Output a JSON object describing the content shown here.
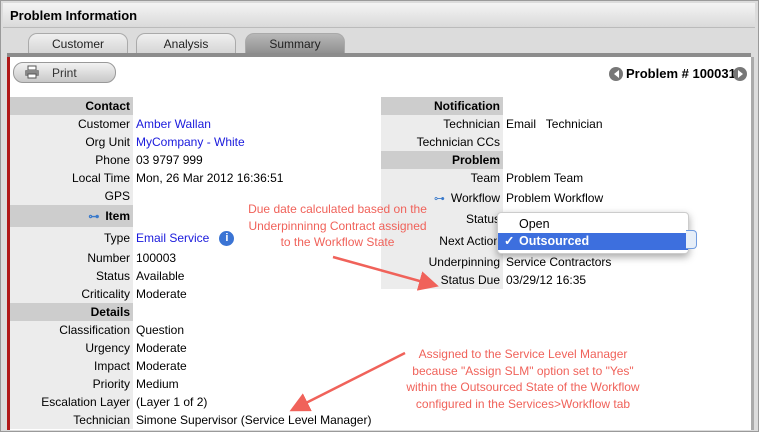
{
  "window": {
    "title": "Problem Information"
  },
  "tabs": [
    {
      "label": "Customer"
    },
    {
      "label": "Analysis"
    },
    {
      "label": "Summary",
      "active": true
    }
  ],
  "toolbar": {
    "print_label": "Print"
  },
  "problem_nav": {
    "label": "Problem # 100031"
  },
  "left": [
    {
      "label": "Contact",
      "header": true
    },
    {
      "label": "Customer",
      "value": "Amber Wallan",
      "link": true
    },
    {
      "label": "Org Unit",
      "value": "MyCompany - White",
      "link": true
    },
    {
      "label": "Phone",
      "value": "03 9797 999"
    },
    {
      "label": "Local Time",
      "value": "Mon, 26 Mar 2012 16:36:51"
    },
    {
      "label": "GPS",
      "value": ""
    },
    {
      "label": "Item",
      "header": true,
      "icon": "item-hierarchy-icon"
    },
    {
      "label": "Type",
      "value": "Email Service",
      "link": true,
      "icon": "info-icon"
    },
    {
      "label": "Number",
      "value": "100003"
    },
    {
      "label": "Status",
      "value": "Available"
    },
    {
      "label": "Criticality",
      "value": "Moderate"
    },
    {
      "label": "Details",
      "header": true
    },
    {
      "label": "Classification",
      "value": "Question"
    },
    {
      "label": "Urgency",
      "value": "Moderate"
    },
    {
      "label": "Impact",
      "value": "Moderate"
    },
    {
      "label": "Priority",
      "value": "Medium"
    },
    {
      "label": "Escalation Layer",
      "value": "(Layer 1 of 2)"
    },
    {
      "label": "Technician",
      "value": "Simone Supervisor (Service Level Manager)"
    }
  ],
  "right": [
    {
      "label": "Notification",
      "header": true
    },
    {
      "label": "Technician",
      "value": "Email   Technician"
    },
    {
      "label": "Technician CCs",
      "value": ""
    },
    {
      "label": "Problem",
      "header": true
    },
    {
      "label": "Team",
      "value": "Problem Team"
    },
    {
      "label": "Workflow",
      "value": "Problem Workflow",
      "icon": "workflow-icon"
    },
    {
      "label": "Status",
      "value": ""
    },
    {
      "label": "Next Action",
      "value": ""
    },
    {
      "label": "Underpinning Contract",
      "value": "Service Contractors"
    },
    {
      "label": "Status Due",
      "value": "03/29/12 16:35"
    }
  ],
  "dropdown": {
    "options": [
      "Open",
      "Outsourced"
    ],
    "selected": "Outsourced",
    "check": "✓"
  },
  "annotations": [
    "Due date calculated based on the Underpinninng Contract assigned to the Workflow State",
    "Assigned to the Service Level Manager because \"Assign SLM\" option set to \"Yes\" within the Outsourced State of the Workflow configured in the Services>Workflow tab"
  ],
  "colors": {
    "accent": "#b01818",
    "link": "#1a1adc",
    "annotation": "#f0625a",
    "selection": "#3d6fde"
  }
}
